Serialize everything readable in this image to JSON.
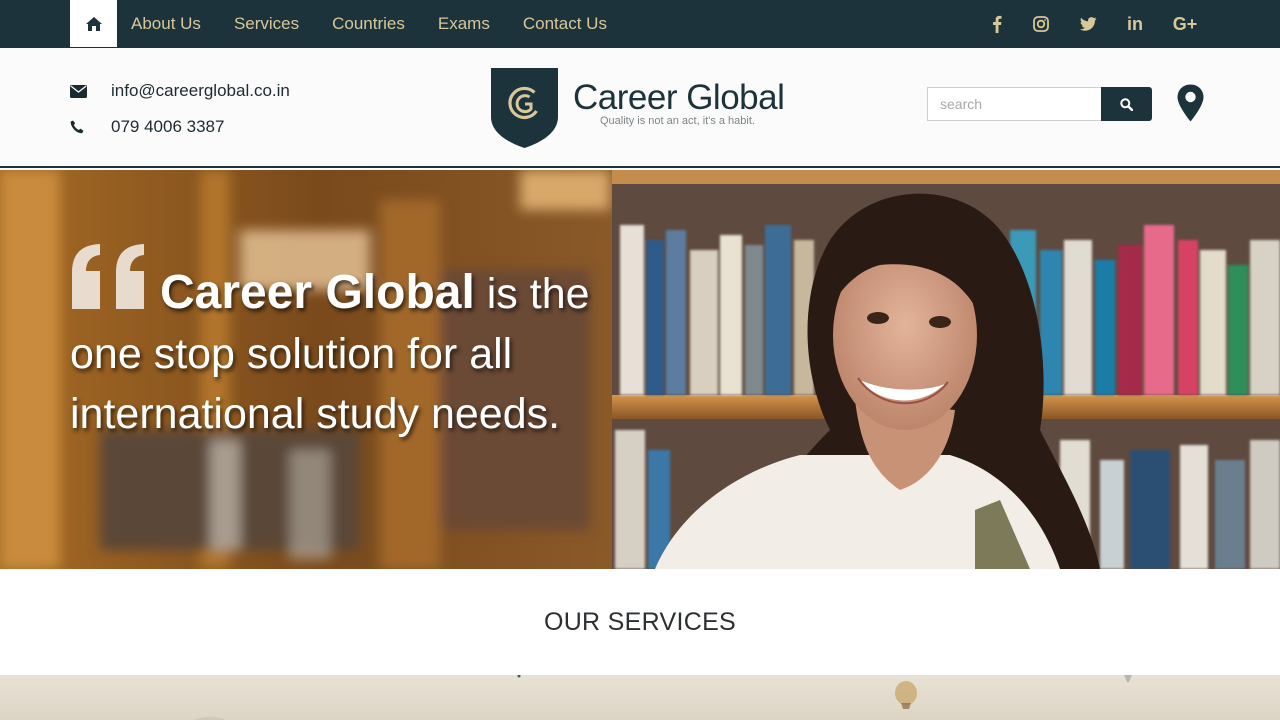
{
  "nav": {
    "home_icon": "home-icon",
    "links": [
      "About Us",
      "Services",
      "Countries",
      "Exams",
      "Contact Us"
    ],
    "social": [
      "facebook-icon",
      "instagram-icon",
      "twitter-icon",
      "linkedin-icon",
      "google-plus-icon"
    ],
    "linkedin_text": "in",
    "gplus_text": "G+"
  },
  "header": {
    "email": "info@careerglobal.co.in",
    "phone": "079 4006 3387",
    "brand_name": "Career Global",
    "tagline": "Quality is not an act, it's a habit.",
    "search_placeholder": "search"
  },
  "hero": {
    "headline_bold": "Career Global",
    "headline_rest": " is the",
    "line2": "one stop solution for all",
    "line3": "international study needs."
  },
  "services": {
    "title": "OUR SERVICES"
  },
  "colors": {
    "nav_bg": "#1c333b",
    "nav_link": "#d8c79a",
    "brand": "#1c333b",
    "gold": "#d8c79a"
  }
}
